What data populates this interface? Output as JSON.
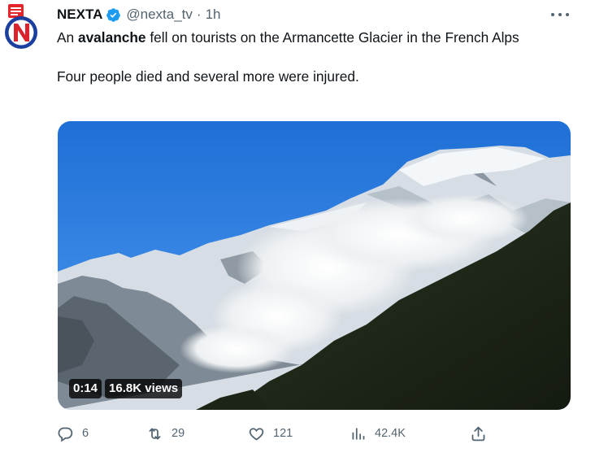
{
  "tweet": {
    "author_name": "NEXTA",
    "author_handle": "@nexta_tv",
    "separator": "·",
    "time": "1h",
    "text_before": "An ",
    "text_bold": "avalanche",
    "text_after": " fell on tourists on the Armancette Glacier in the French Alps",
    "text_second": "Four people died and several more were injured.",
    "avatar_icon": "nexta-logo",
    "verified_color": "#1d9bf0"
  },
  "media": {
    "duration": "0:14",
    "views_label": "16.8K views"
  },
  "actions": {
    "replies": "6",
    "retweets": "29",
    "likes": "121",
    "views": "42.4K"
  }
}
